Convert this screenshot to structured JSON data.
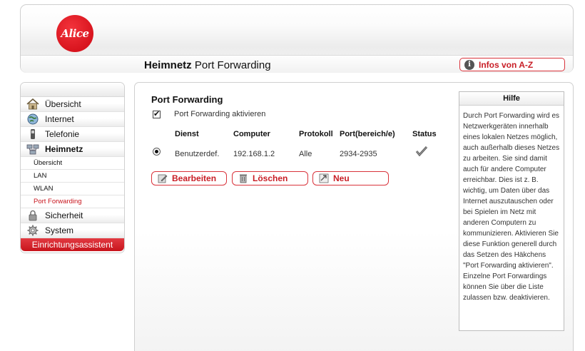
{
  "header": {
    "logo_text": "Alice",
    "title_bold": "Heimnetz",
    "title_rest": "Port Forwarding",
    "infos_button": "Infos von A-Z"
  },
  "sidebar": {
    "items": [
      {
        "label": "Übersicht",
        "icon": "home-icon"
      },
      {
        "label": "Internet",
        "icon": "globe-icon"
      },
      {
        "label": "Telefonie",
        "icon": "phone-icon"
      },
      {
        "label": "Heimnetz",
        "icon": "network-icon"
      }
    ],
    "subitems": [
      {
        "label": "Übersicht"
      },
      {
        "label": "LAN"
      },
      {
        "label": "WLAN"
      },
      {
        "label": "Port Forwarding"
      }
    ],
    "items_after": [
      {
        "label": "Sicherheit",
        "icon": "lock-icon"
      },
      {
        "label": "System",
        "icon": "gear-icon"
      }
    ],
    "wizard": "Einrichtungsassistent"
  },
  "main": {
    "section_title": "Port Forwarding",
    "enable_label": "Port Forwarding aktivieren",
    "enable_checked": true,
    "columns": [
      "Dienst",
      "Computer",
      "Protokoll",
      "Port(bereich/e)",
      "Status"
    ],
    "rows": [
      {
        "dienst": "Benutzerdef.",
        "computer": "192.168.1.2",
        "protokoll": "Alle",
        "port": "2934-2935",
        "status": "check-icon",
        "selected": true
      }
    ],
    "buttons": {
      "edit": "Bearbeiten",
      "delete": "Löschen",
      "new": "Neu"
    }
  },
  "help": {
    "title": "Hilfe",
    "text": "Durch Port Forwarding wird es Netzwerkgeräten innerhalb eines lokalen Netzes möglich, auch außerhalb dieses Netzes zu arbeiten. Sie sind damit auch für andere Computer erreichbar. Dies ist z. B. wichtig, um Daten über das Internet auszutauschen oder bei Spielen im Netz mit anderen Computern zu kommunizieren. Aktivieren Sie diese Funktion generell durch das Setzen des Häkchens \"Port Forwarding aktivieren\". Einzelne Port Forwardings können Sie über die Liste zulassen bzw. deaktivieren."
  },
  "colors": {
    "accent": "#c81e26",
    "logo_red": "#e3202a"
  }
}
